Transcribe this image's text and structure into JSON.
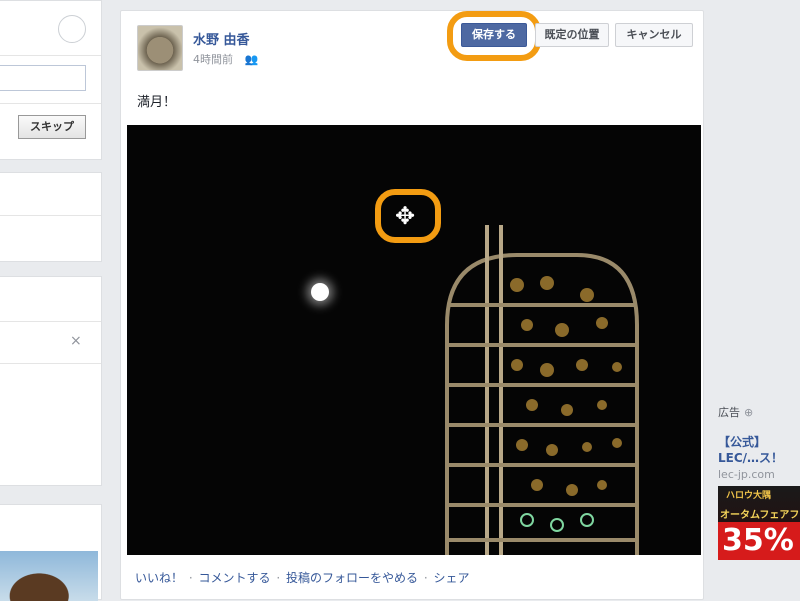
{
  "left": {
    "skip_label": "スキップ",
    "close_glyph": "×"
  },
  "post": {
    "author": "水野 由香",
    "time": "4時間前",
    "status": "満月！",
    "save_label": "保存する",
    "position_label": "既定の位置",
    "cancel_label": "キャンセル",
    "move_icon": "move-icon"
  },
  "actions": {
    "like": "いいね！",
    "comment": "コメントする",
    "unfollow": "投稿のフォローをやめる",
    "share": "シェア",
    "separator": "·"
  },
  "ad": {
    "label": "広告",
    "label_sub": "⊕",
    "title": "【公式】LEC/…ス！",
    "domain": "lec-jp.com",
    "banner_line1": "ハロウ大隅",
    "banner_line2": "オータムフェアフ",
    "banner_big": "35%"
  },
  "colors": {
    "accent": "#f39c12",
    "link": "#365899",
    "save_button": "#4e69a2"
  }
}
